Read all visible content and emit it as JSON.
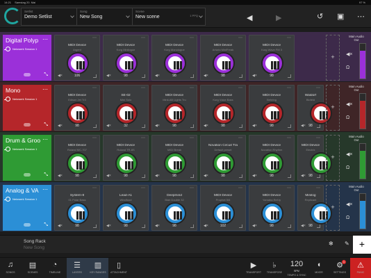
{
  "status": {
    "time": "14:21",
    "device": "Samstag 20. Mai",
    "battery": "97 %"
  },
  "topbar": {
    "setlist_caption": "Setlist",
    "setlist_value": "Demo Setlist",
    "song_caption": "Song",
    "song_value": "New Song",
    "scene_caption": "Scene",
    "scene_value": "New scene",
    "scene_extra": "1 PPQ"
  },
  "rows": [
    {
      "name": "Digital Polyp",
      "session": "Netzwerk Session 1",
      "color": "#9b30d9",
      "devices": [
        {
          "name": "MIDI Device",
          "patch": "Argent",
          "volume": "106"
        },
        {
          "name": "MIDI Device",
          "patch": "Korg Minilogue",
          "volume": "98"
        },
        {
          "name": "MIDI Device",
          "patch": "Korg Monologue",
          "volume": "98"
        },
        {
          "name": "MIDI Device",
          "patch": "Arturia MiniFreak",
          "volume": "98"
        },
        {
          "name": "MIDI Device",
          "patch": "Korg Wave FM 3",
          "volume": "98"
        }
      ]
    },
    {
      "name": "Mono",
      "session": "Netzwerk Session 1",
      "color": "#b5262a",
      "devices": [
        {
          "name": "MIDI Device",
          "patch": "Edison Jet Tr3",
          "volume": "98"
        },
        {
          "name": "SE-02",
          "patch": "Mini Solo",
          "volume": "32"
        },
        {
          "name": "MIDI Device",
          "patch": "MiniLAB Lights Tru",
          "volume": "98"
        },
        {
          "name": "MIDI Device",
          "patch": "Korg Voice Bass",
          "volume": "98"
        },
        {
          "name": "MIDI Device",
          "patch": "Behring",
          "volume": "98"
        },
        {
          "name": "Waldorf",
          "patch": "Blofeld",
          "volume": "98"
        }
      ]
    },
    {
      "name": "Drum & Groo",
      "session": "Netzwerk Session 1",
      "color": "#2f9b34",
      "devices": [
        {
          "name": "MIDI Device",
          "patch": "Roland MC-707",
          "volume": "98"
        },
        {
          "name": "MIDI Device",
          "patch": "Roland TR-8S",
          "volume": "98"
        },
        {
          "name": "MIDI Device",
          "patch": "MIDI Break",
          "volume": "98"
        },
        {
          "name": "Novation Circuit Tra",
          "patch": "Default preset",
          "volume": "98"
        },
        {
          "name": "MIDI Device",
          "patch": "Novation Rhythm",
          "volume": "98"
        },
        {
          "name": "MIDI Device",
          "patch": "Electrix",
          "volume": "98"
        }
      ]
    },
    {
      "name": "Analog & VA",
      "session": "Netzwerk Session 1",
      "color": "#2b8fd6",
      "devices": [
        {
          "name": "System-8",
          "patch": "01 Polar Bass",
          "volume": "98"
        },
        {
          "name": "Lead-A1",
          "patch": "Windfood",
          "volume": "98"
        },
        {
          "name": "Deepmind",
          "patch": "Blair Double 32",
          "volume": "98"
        },
        {
          "name": "MIDI Device",
          "patch": "Prophet 5/6",
          "volume": "102"
        },
        {
          "name": "MIDI Device",
          "patch": "Yamaha Ref.ty",
          "volume": "98"
        },
        {
          "name": "Minilog",
          "patch": "Replicant",
          "volume": "98"
        }
      ]
    }
  ],
  "main_out": {
    "label": "Main Audio Out"
  },
  "rack": {
    "title": "Song Rack",
    "subtitle": "New Song"
  },
  "tabs": [
    {
      "label": "SONGS",
      "glyph": "♫"
    },
    {
      "label": "SCENES",
      "glyph": "▤"
    },
    {
      "label": "TIMELINE",
      "glyph": "◔"
    },
    {
      "label": "LAYERS",
      "glyph": "☰"
    },
    {
      "label": "KEY RANGES",
      "glyph": "▥"
    },
    {
      "label": "ATTACHMENT",
      "glyph": "▯"
    }
  ],
  "right_tabs": [
    {
      "label": "TRANSPORT",
      "glyph": "▶"
    },
    {
      "label": "TRANSPOSE",
      "glyph": "♭"
    },
    {
      "label": "TEMPO & SYNC",
      "glyph": "120"
    },
    {
      "label": "MIXER",
      "glyph": "◖"
    },
    {
      "label": "SETTINGS",
      "glyph": "⚙"
    },
    {
      "label": "PANIC",
      "glyph": "⚠"
    }
  ],
  "tempo": {
    "bpm_label": "BPM"
  },
  "settings_badge": "1"
}
